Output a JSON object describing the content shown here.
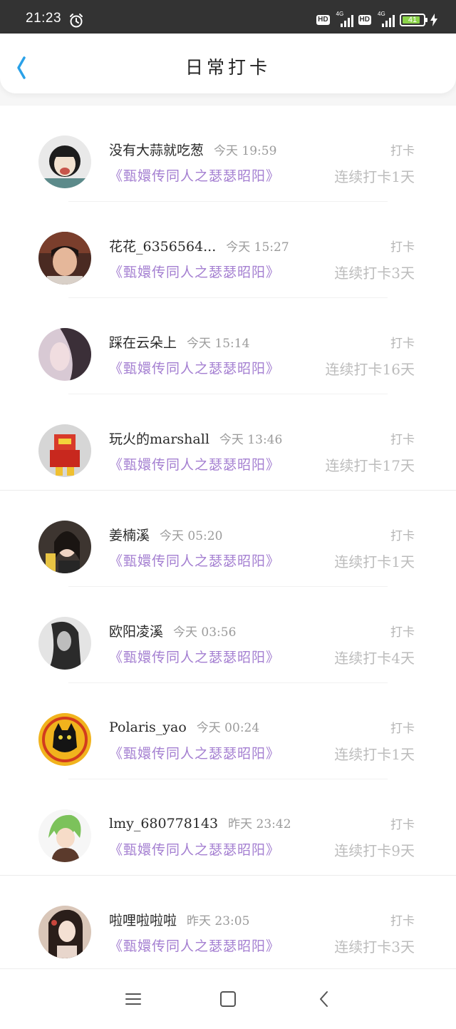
{
  "status_bar": {
    "time": "21:23",
    "hd_badge_1": "HD",
    "hd_badge_2": "HD",
    "network_1": "4G",
    "network_2": "4G",
    "battery": "41"
  },
  "header": {
    "title": "日常打卡",
    "back_icon": "chevron-left-icon",
    "accent_color": "#2aa1e8"
  },
  "checkins": [
    {
      "name": "没有大蒜就吃葱",
      "time": "今天 19:59",
      "action": "打卡",
      "book": "《甄嬛传同人之瑟瑟昭阳》",
      "streak": "连续打卡1天"
    },
    {
      "name": "花花_6356564...",
      "time": "今天 15:27",
      "action": "打卡",
      "book": "《甄嬛传同人之瑟瑟昭阳》",
      "streak": "连续打卡3天"
    },
    {
      "name": "踩在云朵上",
      "time": "今天 15:14",
      "action": "打卡",
      "book": "《甄嬛传同人之瑟瑟昭阳》",
      "streak": "连续打卡16天"
    },
    {
      "name": "玩火的marshall",
      "time": "今天 13:46",
      "action": "打卡",
      "book": "《甄嬛传同人之瑟瑟昭阳》",
      "streak": "连续打卡17天"
    },
    {
      "name": "姜楠溪",
      "time": "今天 05:20",
      "action": "打卡",
      "book": "《甄嬛传同人之瑟瑟昭阳》",
      "streak": "连续打卡1天"
    },
    {
      "name": "欧阳凌溪",
      "time": "今天 03:56",
      "action": "打卡",
      "book": "《甄嬛传同人之瑟瑟昭阳》",
      "streak": "连续打卡4天"
    },
    {
      "name": "Polaris_yao",
      "time": "今天 00:24",
      "action": "打卡",
      "book": "《甄嬛传同人之瑟瑟昭阳》",
      "streak": "连续打卡1天"
    },
    {
      "name": "lmy_680778143",
      "time": "昨天 23:42",
      "action": "打卡",
      "book": "《甄嬛传同人之瑟瑟昭阳》",
      "streak": "连续打卡9天"
    },
    {
      "name": "啦哩啦啦啦",
      "time": "昨天 23:05",
      "action": "打卡",
      "book": "《甄嬛传同人之瑟瑟昭阳》",
      "streak": "连续打卡3天"
    }
  ],
  "colors": {
    "book_title": "#a47fd1",
    "status_bar_bg": "#333333",
    "battery_fill": "#8bd34a"
  },
  "nav_bar": {
    "menu_icon": "menu-icon",
    "home_icon": "square-home-icon",
    "back_icon": "triangle-back-icon"
  }
}
